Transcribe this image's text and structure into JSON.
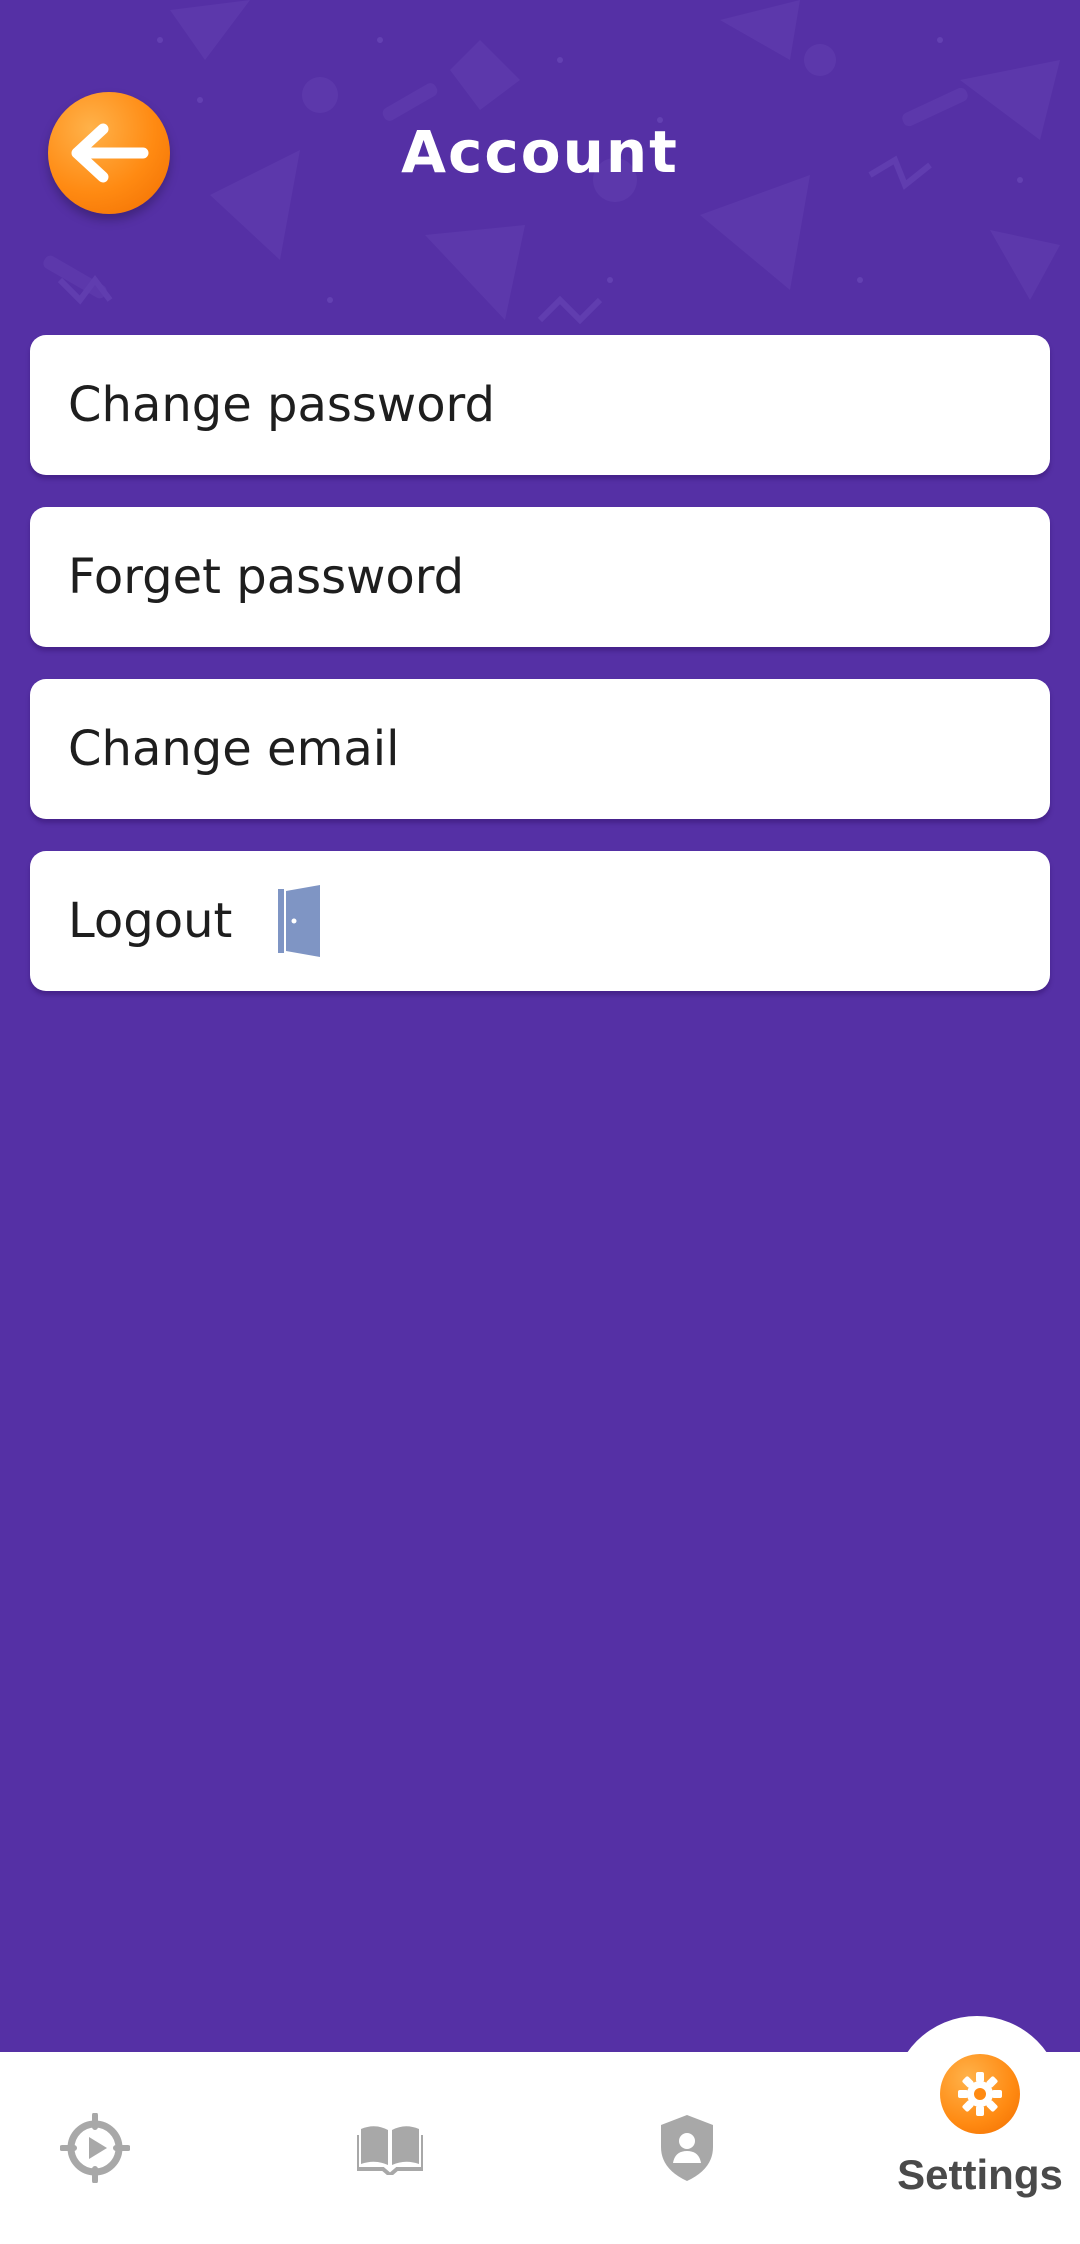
{
  "header": {
    "title": "Account",
    "back_icon": "arrow-left-icon"
  },
  "menu": {
    "items": [
      {
        "label": "Change password"
      },
      {
        "label": "Forget password"
      },
      {
        "label": "Change email"
      },
      {
        "label": "Logout",
        "icon": "door-icon"
      }
    ]
  },
  "bottom_nav": {
    "items": [
      {
        "icon": "play-target-icon",
        "active": false
      },
      {
        "icon": "book-icon",
        "active": false
      },
      {
        "icon": "shield-user-icon",
        "active": false
      },
      {
        "icon": "gear-icon",
        "label": "Settings",
        "active": true
      }
    ]
  },
  "colors": {
    "background": "#5530a5",
    "accent": "#ff8a12",
    "card": "#ffffff",
    "nav_icon": "#a8a8a8",
    "door_icon": "#7f95c4"
  }
}
